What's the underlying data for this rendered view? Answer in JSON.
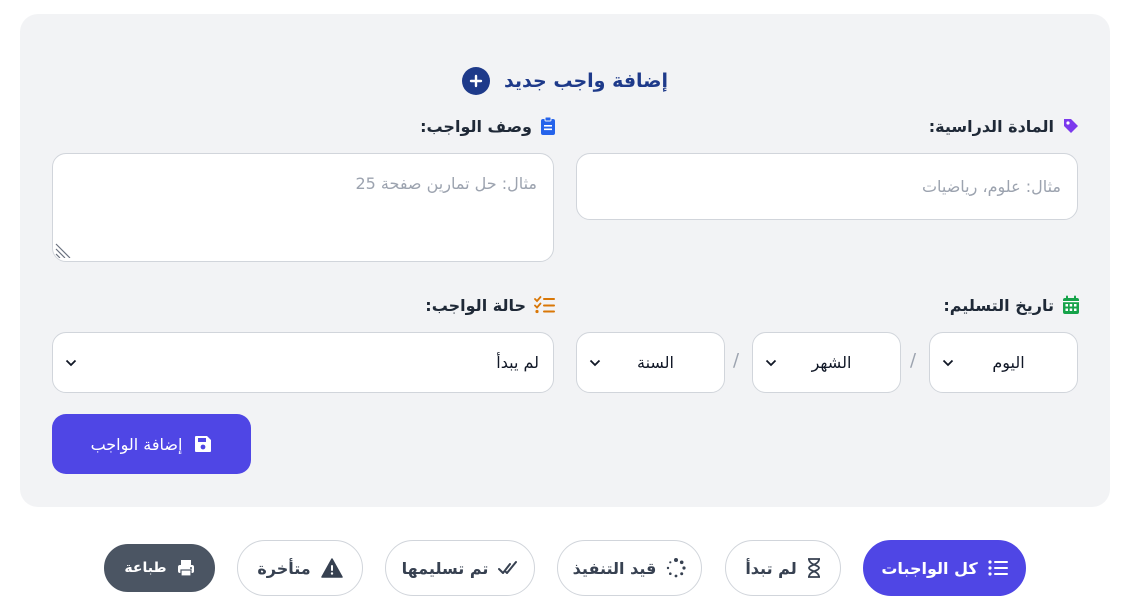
{
  "form": {
    "title": "إضافة واجب جديد",
    "subject_label": "المادة الدراسية:",
    "subject_placeholder": "مثال: علوم، رياضيات",
    "description_label": "وصف الواجب:",
    "description_placeholder": "مثال: حل تمارين صفحة 25",
    "due_date_label": "تاريخ التسليم:",
    "day_value": "اليوم",
    "month_value": "الشهر",
    "year_value": "السنة",
    "date_separator": "/",
    "status_label": "حالة الواجب:",
    "status_value": "لم يبدأ",
    "submit_label": "إضافة الواجب"
  },
  "filters": {
    "all": "كل الواجبات",
    "not_started": "لم تبدأ",
    "in_progress": "قيد التنفيذ",
    "submitted": "تم تسليمها",
    "late": "متأخرة",
    "print": "طباعة"
  },
  "colors": {
    "accent": "#4f46e5",
    "title": "#1e3a8a",
    "tag_icon": "#7c3aed",
    "clipboard_icon": "#2563eb",
    "calendar_icon": "#16a34a",
    "status_icon": "#d97706",
    "print_button": "#4b5563"
  },
  "icons": {
    "title": "plus-circle-icon",
    "subject": "tag-icon",
    "description": "clipboard-icon",
    "due_date": "calendar-icon",
    "status": "checklist-icon",
    "submit": "save-icon"
  }
}
